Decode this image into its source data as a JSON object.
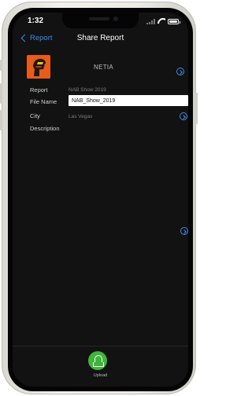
{
  "status_bar": {
    "time": "1:32"
  },
  "navbar": {
    "back_label": "Report",
    "title": "Share Report"
  },
  "header": {
    "company_name": "NETIA",
    "logo_icon": "netia-head-logo-icon",
    "logo_color": "#e95b1a"
  },
  "fields": {
    "report": {
      "label": "Report",
      "value": "NAB Show 2019"
    },
    "file_name": {
      "label": "File Name",
      "value": "NAB_Show_2019"
    },
    "city": {
      "label": "City",
      "value": "Las Vegas"
    },
    "description": {
      "label": "Description",
      "value": ""
    }
  },
  "actions": {
    "upload_label": "Upload",
    "upload_icon": "upload-cloud-icon",
    "upload_color": "#3fb53b"
  },
  "theme": {
    "accent": "#3a8ee6",
    "background": "#121212"
  }
}
